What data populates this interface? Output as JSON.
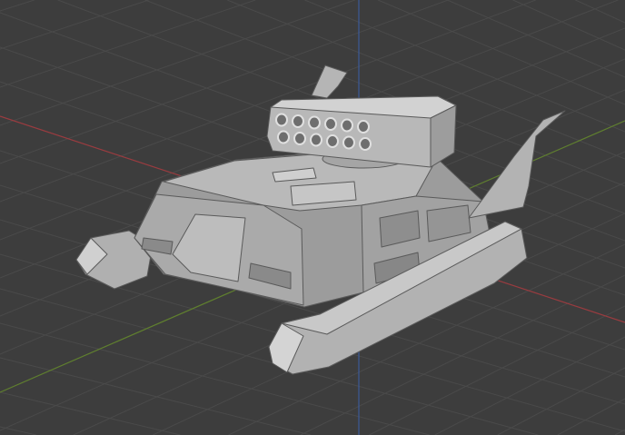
{
  "viewport": {
    "mode": "solid-shading",
    "colors": {
      "background": "#3d3d3d",
      "grid": "#4a4a4a",
      "x_axis": "#9a3b3f",
      "y_axis": "#5f7f2e",
      "z_axis": "#3b5a9a",
      "model_light": "#c4c4c4",
      "model_mid": "#a8a8a8",
      "model_dark": "#7e7e7e",
      "edge": "#5a5a5a"
    }
  },
  "model": {
    "icon": "tank-hovercraft-model",
    "launcher_tubes_rows": 2,
    "launcher_tubes_cols": 6
  }
}
